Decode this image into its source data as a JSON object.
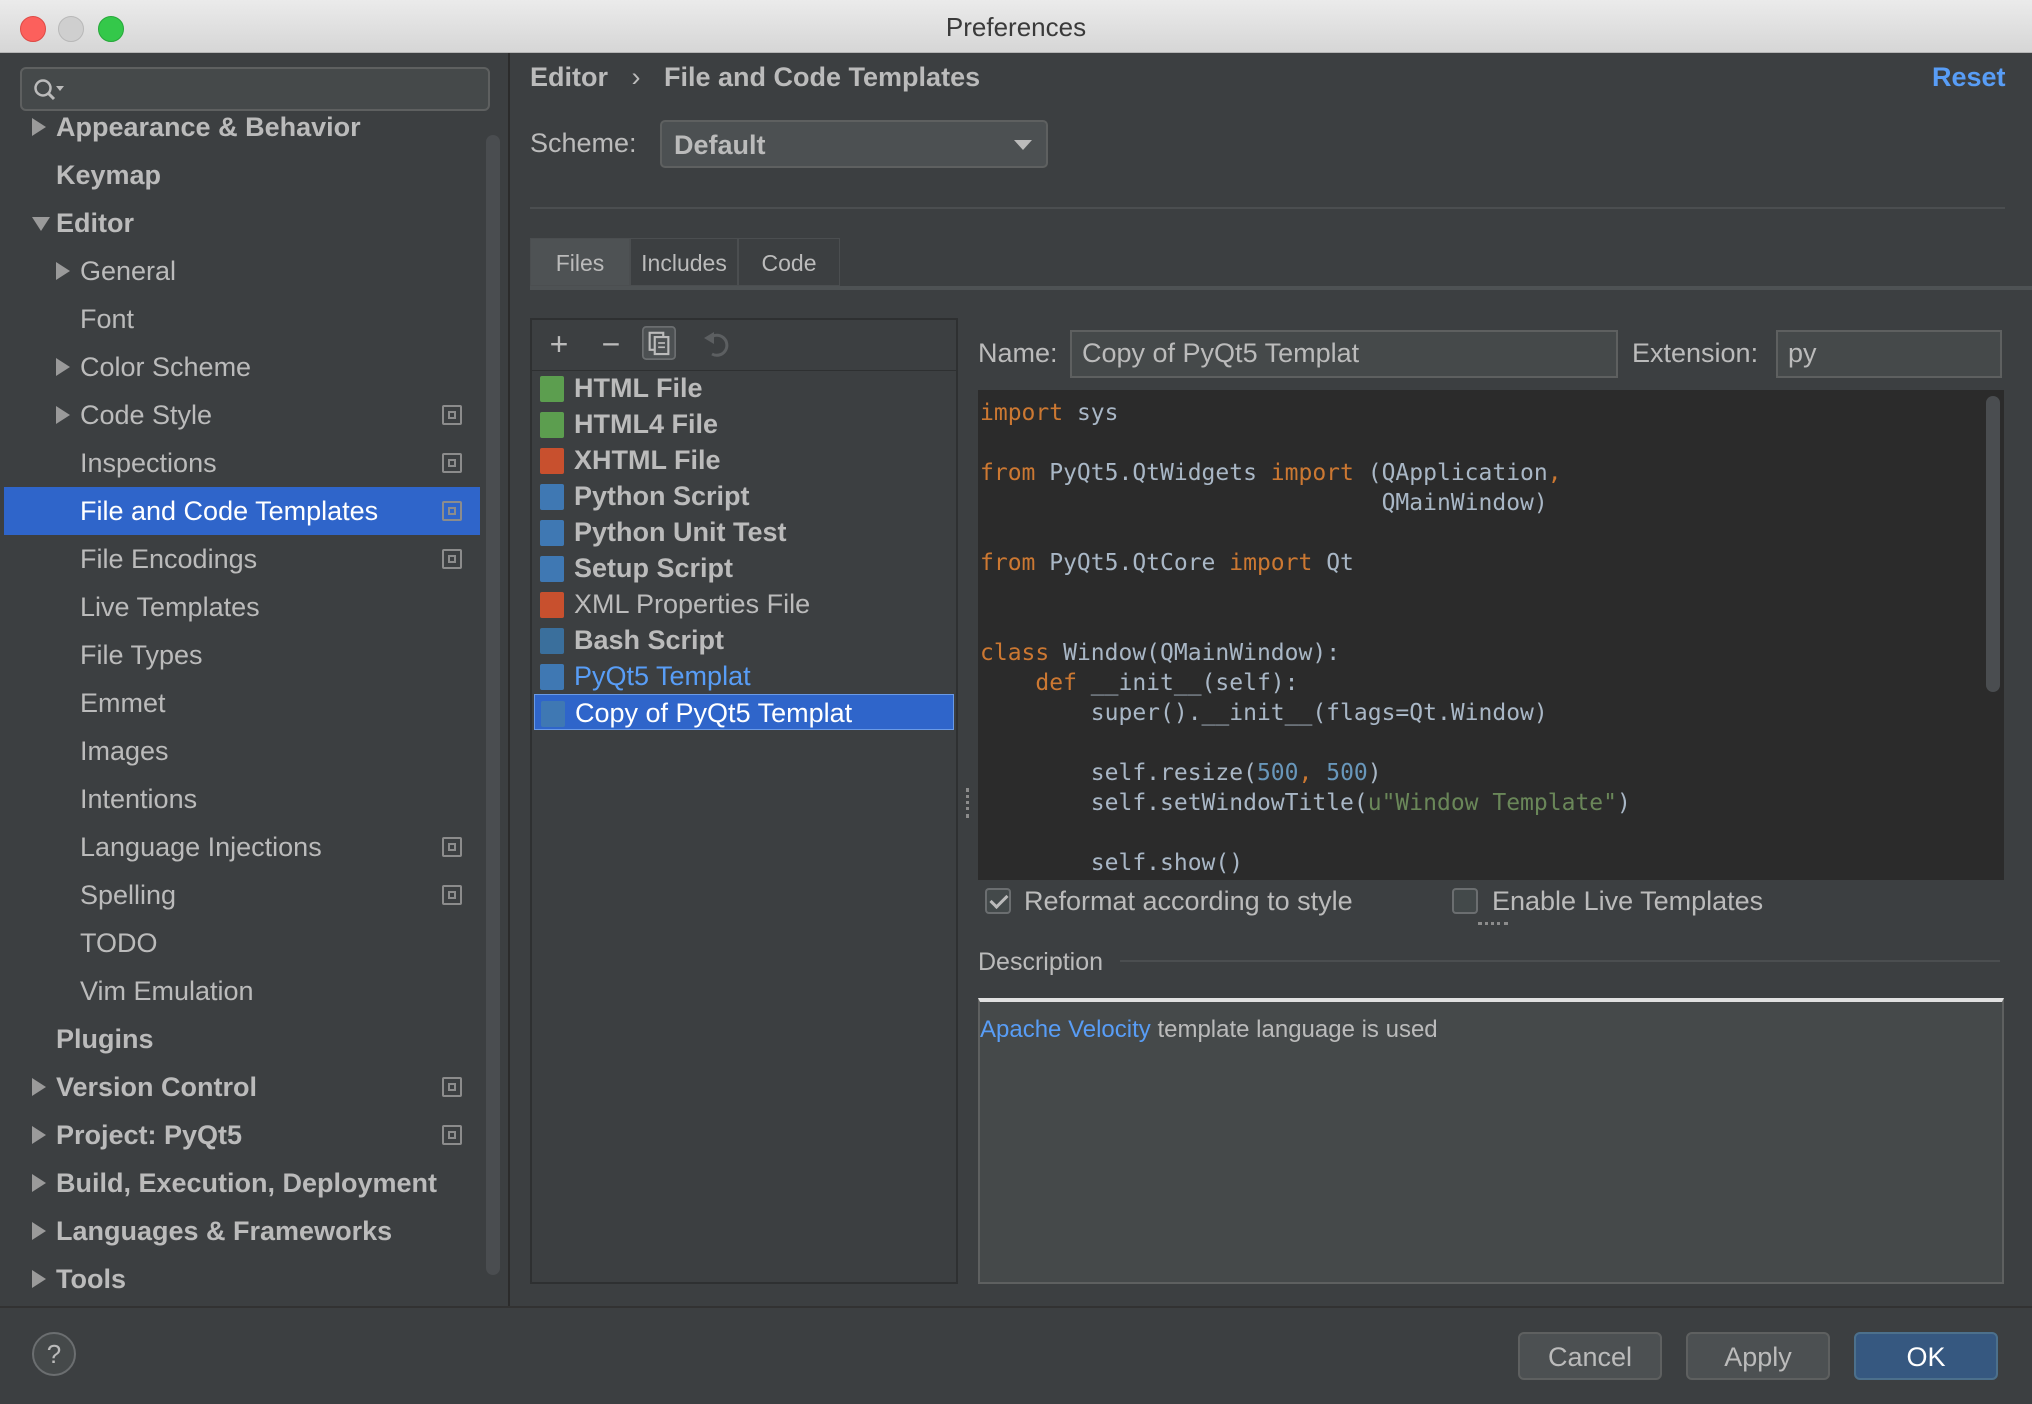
{
  "window": {
    "title": "Preferences"
  },
  "search": {
    "placeholder": ""
  },
  "sidebar": {
    "items": [
      {
        "label": "Appearance & Behavior",
        "level": 0,
        "bold": true,
        "arrow": "right",
        "project_icon": false
      },
      {
        "label": "Keymap",
        "level": 0,
        "bold": true,
        "arrow": "none",
        "project_icon": false
      },
      {
        "label": "Editor",
        "level": 0,
        "bold": true,
        "arrow": "down",
        "project_icon": false
      },
      {
        "label": "General",
        "level": 1,
        "bold": false,
        "arrow": "right",
        "project_icon": false
      },
      {
        "label": "Font",
        "level": 1,
        "bold": false,
        "arrow": "none",
        "project_icon": false
      },
      {
        "label": "Color Scheme",
        "level": 1,
        "bold": false,
        "arrow": "right",
        "project_icon": false
      },
      {
        "label": "Code Style",
        "level": 1,
        "bold": false,
        "arrow": "right",
        "project_icon": true
      },
      {
        "label": "Inspections",
        "level": 1,
        "bold": false,
        "arrow": "none",
        "project_icon": true
      },
      {
        "label": "File and Code Templates",
        "level": 1,
        "bold": false,
        "arrow": "none",
        "project_icon": true,
        "selected": true
      },
      {
        "label": "File Encodings",
        "level": 1,
        "bold": false,
        "arrow": "none",
        "project_icon": true
      },
      {
        "label": "Live Templates",
        "level": 1,
        "bold": false,
        "arrow": "none",
        "project_icon": false
      },
      {
        "label": "File Types",
        "level": 1,
        "bold": false,
        "arrow": "none",
        "project_icon": false
      },
      {
        "label": "Emmet",
        "level": 1,
        "bold": false,
        "arrow": "none",
        "project_icon": false
      },
      {
        "label": "Images",
        "level": 1,
        "bold": false,
        "arrow": "none",
        "project_icon": false
      },
      {
        "label": "Intentions",
        "level": 1,
        "bold": false,
        "arrow": "none",
        "project_icon": false
      },
      {
        "label": "Language Injections",
        "level": 1,
        "bold": false,
        "arrow": "none",
        "project_icon": true
      },
      {
        "label": "Spelling",
        "level": 1,
        "bold": false,
        "arrow": "none",
        "project_icon": true
      },
      {
        "label": "TODO",
        "level": 1,
        "bold": false,
        "arrow": "none",
        "project_icon": false
      },
      {
        "label": "Vim Emulation",
        "level": 1,
        "bold": false,
        "arrow": "none",
        "project_icon": false
      },
      {
        "label": "Plugins",
        "level": 0,
        "bold": true,
        "arrow": "none",
        "project_icon": false
      },
      {
        "label": "Version Control",
        "level": 0,
        "bold": true,
        "arrow": "right",
        "project_icon": true
      },
      {
        "label": "Project: PyQt5",
        "level": 0,
        "bold": true,
        "arrow": "right",
        "project_icon": true
      },
      {
        "label": "Build, Execution, Deployment",
        "level": 0,
        "bold": true,
        "arrow": "right",
        "project_icon": false
      },
      {
        "label": "Languages & Frameworks",
        "level": 0,
        "bold": true,
        "arrow": "right",
        "project_icon": false
      },
      {
        "label": "Tools",
        "level": 0,
        "bold": true,
        "arrow": "right",
        "project_icon": false
      }
    ]
  },
  "breadcrumb": {
    "parent": "Editor",
    "separator": "›",
    "current": "File and Code Templates"
  },
  "reset_label": "Reset",
  "scheme": {
    "label": "Scheme:",
    "value": "Default"
  },
  "tabs": [
    "Files",
    "Includes",
    "Code"
  ],
  "templates": [
    {
      "label": "HTML File",
      "bold": true,
      "icon": "html-file-icon",
      "color": "#5c9e4f"
    },
    {
      "label": "HTML4 File",
      "bold": true,
      "icon": "html4-file-icon",
      "color": "#5c9e4f"
    },
    {
      "label": "XHTML File",
      "bold": true,
      "icon": "xhtml-file-icon",
      "color": "#c8502e"
    },
    {
      "label": "Python Script",
      "bold": true,
      "icon": "python-file-icon",
      "color": "#3f78b3"
    },
    {
      "label": "Python Unit Test",
      "bold": true,
      "icon": "python-file-icon",
      "color": "#3f78b3"
    },
    {
      "label": "Setup Script",
      "bold": true,
      "icon": "python-file-icon",
      "color": "#3f78b3"
    },
    {
      "label": "XML Properties File",
      "bold": false,
      "icon": "xml-file-icon",
      "color": "#c8502e"
    },
    {
      "label": "Bash Script",
      "bold": true,
      "icon": "bash-file-icon",
      "color": "#3a6f9c"
    },
    {
      "label": "PyQt5 Templat",
      "bold": false,
      "link": true,
      "icon": "python-file-icon",
      "color": "#3f78b3"
    },
    {
      "label": "Copy of PyQt5 Templat",
      "bold": false,
      "selected": true,
      "icon": "python-file-icon",
      "color": "#3f78b3"
    }
  ],
  "name_field": {
    "label": "Name:",
    "value": "Copy of PyQt5 Templat"
  },
  "extension_field": {
    "label": "Extension:",
    "value": "py"
  },
  "code": [
    [
      [
        "kw",
        "import"
      ],
      [
        "t",
        " sys"
      ]
    ],
    [],
    [
      [
        "kw",
        "from"
      ],
      [
        "t",
        " PyQt5.QtWidgets "
      ],
      [
        "kw",
        "import"
      ],
      [
        "t",
        " (QApplication"
      ],
      [
        "kw",
        ","
      ]
    ],
    [
      [
        "t",
        "                             QMainWindow)"
      ]
    ],
    [],
    [
      [
        "kw",
        "from"
      ],
      [
        "t",
        " PyQt5.QtCore "
      ],
      [
        "kw",
        "import"
      ],
      [
        "t",
        " Qt"
      ]
    ],
    [],
    [],
    [
      [
        "kw",
        "class"
      ],
      [
        "t",
        " Window(QMainWindow):"
      ]
    ],
    [
      [
        "t",
        "    "
      ],
      [
        "kw",
        "def"
      ],
      [
        "t",
        " __init__(self):"
      ]
    ],
    [
      [
        "t",
        "        super().__init__(flags=Qt.Window)"
      ]
    ],
    [],
    [
      [
        "t",
        "        self.resize("
      ],
      [
        "num",
        "500"
      ],
      [
        "kw",
        ","
      ],
      [
        "t",
        " "
      ],
      [
        "num",
        "500"
      ],
      [
        "t",
        ")"
      ]
    ],
    [
      [
        "t",
        "        self.setWindowTitle("
      ],
      [
        "str",
        "u\"Window Template\""
      ],
      [
        "t",
        ")"
      ]
    ],
    [],
    [
      [
        "t",
        "        self.show()"
      ]
    ]
  ],
  "options": {
    "reformat_label": "Reformat according to style",
    "reformat_checked": true,
    "live_label": "Enable Live Templates",
    "live_checked": false
  },
  "description": {
    "title": "Description",
    "link": "Apache Velocity",
    "text": " template language is used"
  },
  "buttons": {
    "help": "?",
    "cancel": "Cancel",
    "apply": "Apply",
    "ok": "OK"
  }
}
